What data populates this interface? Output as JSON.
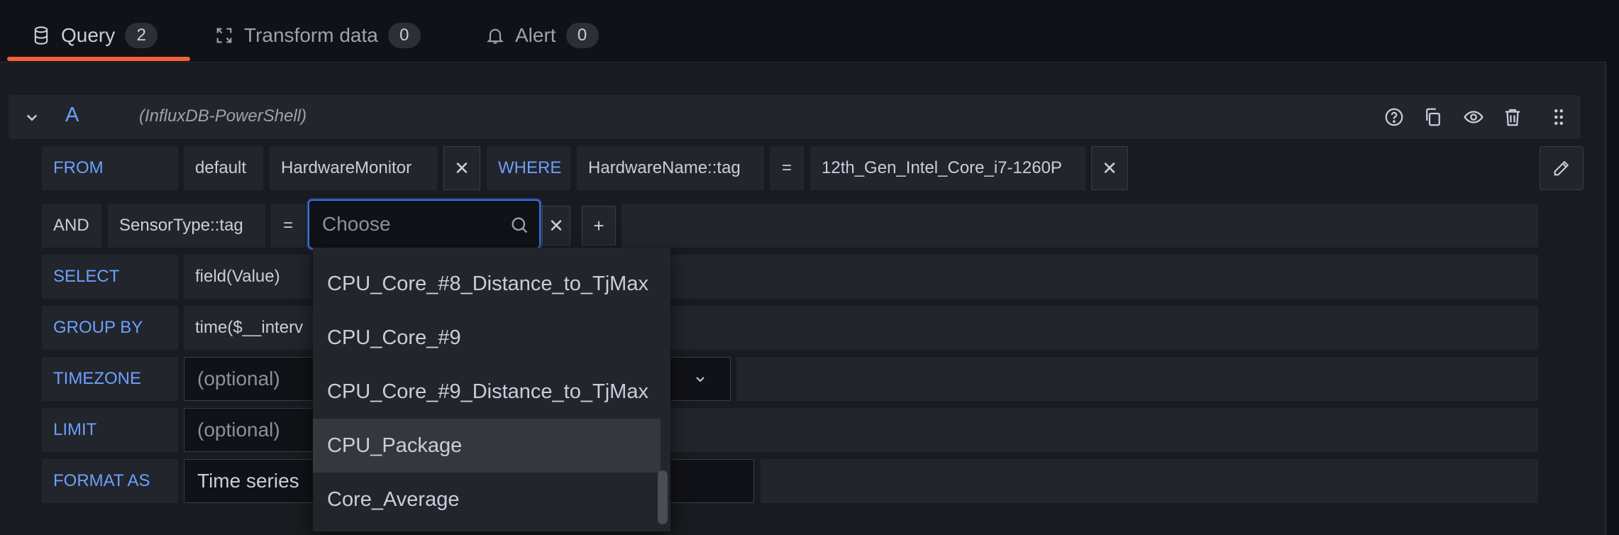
{
  "tabs": [
    {
      "label": "Query",
      "count": "2",
      "icon": "database-icon",
      "active": true
    },
    {
      "label": "Transform data",
      "count": "0",
      "icon": "transform-icon",
      "active": false
    },
    {
      "label": "Alert",
      "count": "0",
      "icon": "bell-icon",
      "active": false
    }
  ],
  "query": {
    "ref_id": "A",
    "datasource": "(InfluxDB-PowerShell)",
    "header_icons": [
      "help-icon",
      "copy-icon",
      "eye-icon",
      "trash-icon",
      "drag-handle-icon"
    ]
  },
  "rows": {
    "from": {
      "keyword": "FROM",
      "policy": "default",
      "measurement": "HardwareMonitor",
      "remove": "✕",
      "where_keyword": "WHERE",
      "tag": "HardwareName::tag",
      "operator": "=",
      "value": "12th_Gen_Intel_Core_i7-1260P"
    },
    "and": {
      "keyword": "AND",
      "tag": "SensorType::tag",
      "operator": "=",
      "value_placeholder": "Choose",
      "remove": "✕",
      "add": "+"
    },
    "select": {
      "keyword": "SELECT",
      "field": "field(Value)"
    },
    "group_by": {
      "keyword": "GROUP BY",
      "value": "time($__interv"
    },
    "timezone": {
      "keyword": "TIMEZONE",
      "placeholder": "(optional)"
    },
    "limit": {
      "keyword": "LIMIT",
      "placeholder": "(optional)"
    },
    "format_as": {
      "keyword": "FORMAT AS",
      "value": "Time series"
    }
  },
  "dropdown": {
    "options": [
      "CPU_Core_#8_Distance_to_TjMax",
      "CPU_Core_#9",
      "CPU_Core_#9_Distance_to_TjMax",
      "CPU_Package",
      "Core_Average"
    ],
    "highlighted": "CPU_Package"
  },
  "colors": {
    "accent": "#6e9fff",
    "tab_underline": "#f55f3e",
    "focus_border": "#3d71d9",
    "background": "#111217",
    "row_background": "#22252b"
  }
}
